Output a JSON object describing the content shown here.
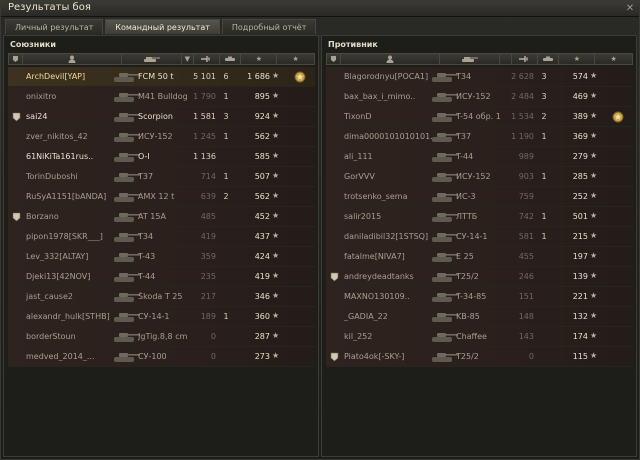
{
  "window": {
    "title": "Результаты боя"
  },
  "tabs": [
    {
      "label": "Личный результат",
      "active": false
    },
    {
      "label": "Командный результат",
      "active": true
    },
    {
      "label": "Подробный отчёт",
      "active": false
    }
  ],
  "allies": {
    "title": "Союзники",
    "rows": [
      {
        "player": "ArchDevil[YAP]",
        "tank": "FCM 50 t",
        "damage": "5 101",
        "kills": "6",
        "xp": "1 686",
        "alive": true,
        "me": true,
        "squad": false,
        "medal": true
      },
      {
        "player": "onixitro",
        "tank": "M41 Bulldog",
        "damage": "1 790",
        "kills": "1",
        "xp": "895",
        "alive": false,
        "me": false,
        "squad": false,
        "medal": false
      },
      {
        "player": "sai24",
        "tank": "Scorpion",
        "damage": "1 581",
        "kills": "3",
        "xp": "924",
        "alive": true,
        "me": false,
        "squad": true,
        "medal": false
      },
      {
        "player": "zver_nikitos_42",
        "tank": "ИСУ-152",
        "damage": "1 245",
        "kills": "1",
        "xp": "562",
        "alive": false,
        "me": false,
        "squad": false,
        "medal": false
      },
      {
        "player": "61NiKiTa161rus..",
        "tank": "O-I",
        "damage": "1 136",
        "kills": "",
        "xp": "585",
        "alive": true,
        "me": false,
        "squad": false,
        "medal": false
      },
      {
        "player": "TorinDuboshi",
        "tank": "T37",
        "damage": "714",
        "kills": "1",
        "xp": "507",
        "alive": false,
        "me": false,
        "squad": false,
        "medal": false
      },
      {
        "player": "RuSyA1151[bANDA]",
        "tank": "AMX 12 t",
        "damage": "639",
        "kills": "2",
        "xp": "562",
        "alive": false,
        "me": false,
        "squad": false,
        "medal": false
      },
      {
        "player": "Borzano",
        "tank": "AT 15A",
        "damage": "485",
        "kills": "",
        "xp": "452",
        "alive": false,
        "me": false,
        "squad": true,
        "medal": false
      },
      {
        "player": "pipon1978[SKR___]",
        "tank": "T34",
        "damage": "419",
        "kills": "",
        "xp": "437",
        "alive": false,
        "me": false,
        "squad": false,
        "medal": false
      },
      {
        "player": "Lev_332[ALTAY]",
        "tank": "T-43",
        "damage": "359",
        "kills": "",
        "xp": "424",
        "alive": false,
        "me": false,
        "squad": false,
        "medal": false
      },
      {
        "player": "Djeki13[42NOV]",
        "tank": "T-44",
        "damage": "235",
        "kills": "",
        "xp": "419",
        "alive": false,
        "me": false,
        "squad": false,
        "medal": false
      },
      {
        "player": "jast_cause2",
        "tank": "Škoda T 25",
        "damage": "217",
        "kills": "",
        "xp": "346",
        "alive": false,
        "me": false,
        "squad": false,
        "medal": false
      },
      {
        "player": "alexandr_hulk[STHB]",
        "tank": "СУ-14-1",
        "damage": "189",
        "kills": "1",
        "xp": "360",
        "alive": false,
        "me": false,
        "squad": false,
        "medal": false
      },
      {
        "player": "borderStoun",
        "tank": "JgTig.8,8 cm",
        "damage": "0",
        "kills": "",
        "xp": "287",
        "alive": false,
        "me": false,
        "squad": false,
        "medal": false
      },
      {
        "player": "medved_2014_...",
        "tank": "СУ-100",
        "damage": "0",
        "kills": "",
        "xp": "273",
        "alive": false,
        "me": false,
        "squad": false,
        "medal": false
      }
    ]
  },
  "enemies": {
    "title": "Противник",
    "rows": [
      {
        "player": "Blagorodnyu[POCA1]",
        "tank": "T34",
        "damage": "2 628",
        "kills": "3",
        "xp": "574",
        "alive": false,
        "squad": false,
        "medal": false
      },
      {
        "player": "bax_bax_i_mimo..",
        "tank": "ИСУ-152",
        "damage": "2 484",
        "kills": "3",
        "xp": "469",
        "alive": false,
        "squad": false,
        "medal": false
      },
      {
        "player": "TixonD",
        "tank": "T-54 обр. 1",
        "damage": "1 534",
        "kills": "2",
        "xp": "389",
        "alive": false,
        "squad": false,
        "medal": true
      },
      {
        "player": "dima0000101010101..",
        "tank": "T37",
        "damage": "1 190",
        "kills": "1",
        "xp": "369",
        "alive": false,
        "squad": false,
        "medal": false
      },
      {
        "player": "ali_111",
        "tank": "T-44",
        "damage": "989",
        "kills": "",
        "xp": "279",
        "alive": false,
        "squad": false,
        "medal": false
      },
      {
        "player": "GorVVV",
        "tank": "ИСУ-152",
        "damage": "903",
        "kills": "1",
        "xp": "285",
        "alive": false,
        "squad": false,
        "medal": false
      },
      {
        "player": "trotsenko_sema",
        "tank": "ИС-3",
        "damage": "759",
        "kills": "",
        "xp": "252",
        "alive": false,
        "squad": false,
        "medal": false
      },
      {
        "player": "salir2015",
        "tank": "ЛТТБ",
        "damage": "742",
        "kills": "1",
        "xp": "501",
        "alive": false,
        "squad": false,
        "medal": false
      },
      {
        "player": "daniladibil32[1STSQ]",
        "tank": "СУ-14-1",
        "damage": "581",
        "kills": "1",
        "xp": "215",
        "alive": false,
        "squad": false,
        "medal": false
      },
      {
        "player": "fatalme[NIVA7]",
        "tank": "E 25",
        "damage": "455",
        "kills": "",
        "xp": "197",
        "alive": false,
        "squad": false,
        "medal": false
      },
      {
        "player": "andreydeadtanks",
        "tank": "T25/2",
        "damage": "246",
        "kills": "",
        "xp": "139",
        "alive": false,
        "squad": true,
        "medal": false
      },
      {
        "player": "MAXNO130109..",
        "tank": "T-34-85",
        "damage": "151",
        "kills": "",
        "xp": "221",
        "alive": false,
        "squad": false,
        "medal": false
      },
      {
        "player": "_GADIA_22",
        "tank": "KB-85",
        "damage": "148",
        "kills": "",
        "xp": "132",
        "alive": false,
        "squad": false,
        "medal": false
      },
      {
        "player": "kil_252",
        "tank": "Chaffee",
        "damage": "143",
        "kills": "",
        "xp": "174",
        "alive": false,
        "squad": false,
        "medal": false
      },
      {
        "player": "Piato4ok[-SKY-]",
        "tank": "T25/2",
        "damage": "0",
        "kills": "",
        "xp": "115",
        "alive": false,
        "squad": true,
        "medal": false
      }
    ]
  },
  "icons": {
    "close": "close-icon",
    "squad": "squad-icon",
    "player": "player-icon",
    "tank": "tank-icon",
    "sort": "sort-icon",
    "damage": "damage-icon",
    "spot": "spotted-icon",
    "kills": "kills-icon",
    "xp": "star-icon",
    "medal": "medal-icon"
  },
  "colors": {
    "accent_me": "#f2d89c",
    "row_bg": "#2f2320",
    "text_alive": "#e6e0ce",
    "text_dead": "#a59f90"
  }
}
